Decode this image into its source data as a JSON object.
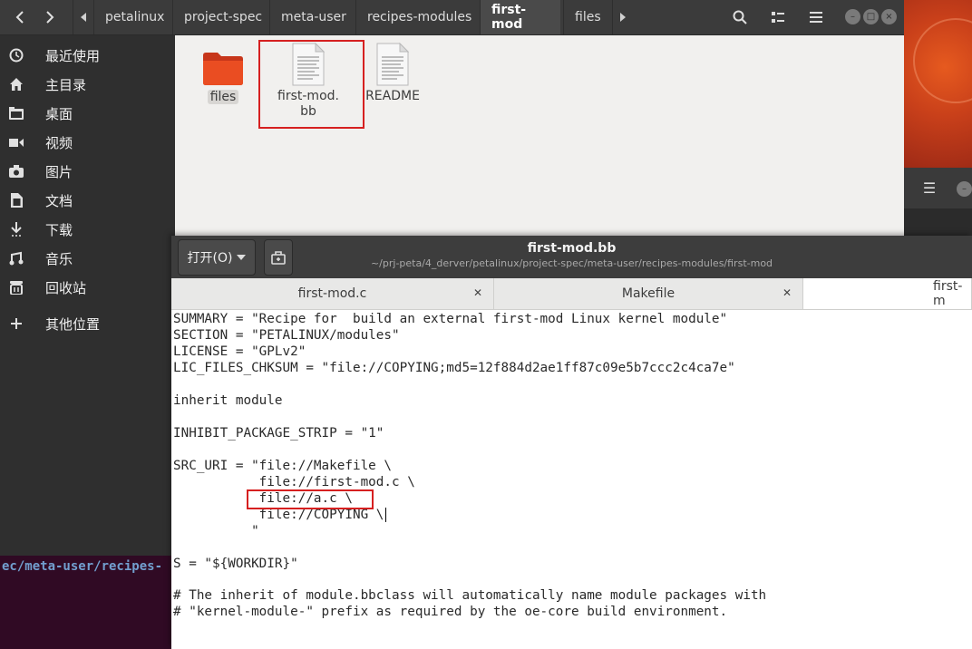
{
  "colors": {
    "highlight": "#d62020",
    "folder": "#e8441c",
    "sidebar_bg": "#2f2f2f",
    "header_bg": "#3b3b3b"
  },
  "file_manager": {
    "breadcrumbs": [
      "petalinux",
      "project-spec",
      "meta-user",
      "recipes-modules",
      "first-mod",
      "files"
    ],
    "active_crumb": "first-mod",
    "sidebar": [
      {
        "icon": "clock-icon",
        "label": "最近使用"
      },
      {
        "icon": "home-icon",
        "label": "主目录"
      },
      {
        "icon": "desktop-folder-icon",
        "label": "桌面"
      },
      {
        "icon": "video-icon",
        "label": "视频"
      },
      {
        "icon": "camera-icon",
        "label": "图片"
      },
      {
        "icon": "document-icon",
        "label": "文档"
      },
      {
        "icon": "download-icon",
        "label": "下载"
      },
      {
        "icon": "music-icon",
        "label": "音乐"
      },
      {
        "icon": "trash-icon",
        "label": "回收站"
      },
      {
        "icon": "plus-icon",
        "label": "其他位置"
      }
    ],
    "files": [
      {
        "name": "files",
        "type": "folder"
      },
      {
        "name_line1": "first-mod.",
        "name_line2": "bb",
        "type": "text"
      },
      {
        "name": "README",
        "type": "text"
      }
    ]
  },
  "terminal": {
    "text": "ec/meta-user/recipes-"
  },
  "gedit": {
    "open_label": "打开(O)",
    "title": "first-mod.bb",
    "subtitle": "~/prj-peta/4_derver/petalinux/project-spec/meta-user/recipes-modules/first-mod",
    "tabs": [
      "first-mod.c",
      "Makefile",
      "first-m"
    ],
    "lines": [
      "SUMMARY = \"Recipe for  build an external first-mod Linux kernel module\"",
      "SECTION = \"PETALINUX/modules\"",
      "LICENSE = \"GPLv2\"",
      "LIC_FILES_CHKSUM = \"file://COPYING;md5=12f884d2ae1ff87c09e5b7ccc2c4ca7e\"",
      "",
      "inherit module",
      "",
      "INHIBIT_PACKAGE_STRIP = \"1\"",
      "",
      "SRC_URI = \"file://Makefile \\",
      "           file://first-mod.c \\",
      "           file://a.c \\",
      "           file://COPYING \\",
      "          \"",
      "",
      "S = \"${WORKDIR}\"",
      "",
      "# The inherit of module.bbclass will automatically name module packages with",
      "# \"kernel-module-\" prefix as required by the oe-core build environment."
    ]
  }
}
